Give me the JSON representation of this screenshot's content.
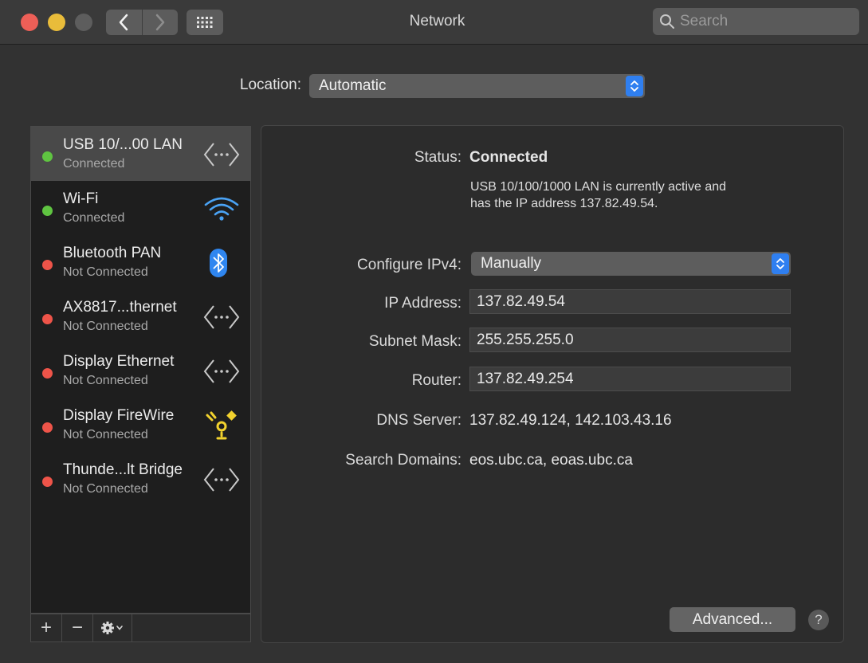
{
  "window": {
    "title": "Network",
    "search_placeholder": "Search"
  },
  "location": {
    "label": "Location:",
    "value": "Automatic"
  },
  "services": [
    {
      "name": "USB 10/...00 LAN",
      "status": "Connected",
      "status_color": "#5fc441",
      "icon": "ethernet-icon",
      "selected": true
    },
    {
      "name": "Wi-Fi",
      "status": "Connected",
      "status_color": "#5fc441",
      "icon": "wifi-icon"
    },
    {
      "name": "Bluetooth PAN",
      "status": "Not Connected",
      "status_color": "#ee5449",
      "icon": "bluetooth-icon"
    },
    {
      "name": "AX8817...thernet",
      "status": "Not Connected",
      "status_color": "#ee5449",
      "icon": "ethernet-icon"
    },
    {
      "name": "Display Ethernet",
      "status": "Not Connected",
      "status_color": "#ee5449",
      "icon": "ethernet-icon"
    },
    {
      "name": "Display FireWire",
      "status": "Not Connected",
      "status_color": "#ee5449",
      "icon": "firewire-icon"
    },
    {
      "name": "Thunde...lt Bridge",
      "status": "Not Connected",
      "status_color": "#ee5449",
      "icon": "ethernet-icon"
    }
  ],
  "toolbar": {
    "add_label": "+",
    "remove_label": "−"
  },
  "details": {
    "status_label": "Status:",
    "status_value": "Connected",
    "status_note_line1": "USB 10/100/1000 LAN is currently active and",
    "status_note_line2": "has the IP address 137.82.49.54.",
    "configure_label": "Configure IPv4:",
    "configure_value": "Manually",
    "ip_label": "IP Address:",
    "ip_value": "137.82.49.54",
    "subnet_label": "Subnet Mask:",
    "subnet_value": "255.255.255.0",
    "router_label": "Router:",
    "router_value": "137.82.49.254",
    "dns_label": "DNS Server:",
    "dns_value": "137.82.49.124, 142.103.43.16",
    "search_domains_label": "Search Domains:",
    "search_domains_value": "eos.ubc.ca, eoas.ubc.ca",
    "advanced_label": "Advanced...",
    "help_label": "?"
  },
  "colors": {
    "accent": "#2f7ff0",
    "connected": "#5fc441",
    "not_connected": "#ee5449"
  }
}
